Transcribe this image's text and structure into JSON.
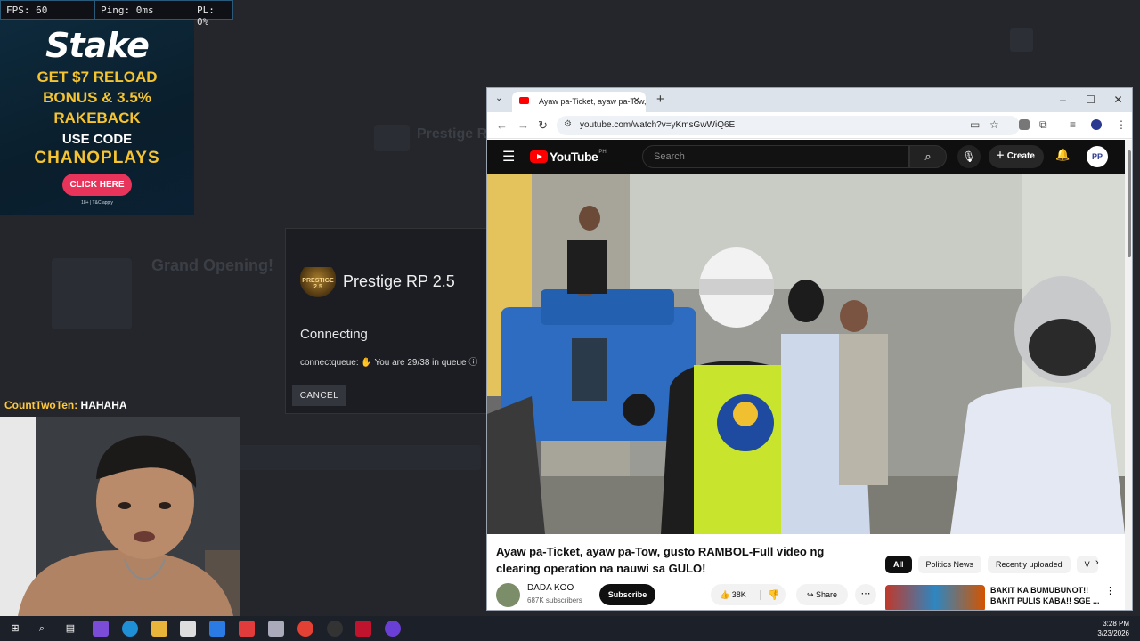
{
  "perf": {
    "fps": "FPS: 60",
    "ping": "Ping: 0ms",
    "pl": "PL: 0%"
  },
  "ad": {
    "brand": "Stake",
    "line1": "GET $7 RELOAD",
    "line2": "BONUS & 3.5%",
    "line3": "RAKEBACK",
    "use_code": "USE CODE",
    "code": "CHANOPLAYS",
    "cta": "CLICK HERE",
    "fine_print": "18+ | T&C apply"
  },
  "background": {
    "heading": "Grand Opening!",
    "server_faded": "Prestige RP"
  },
  "connect_modal": {
    "logo_text": "PRESTIGE 2.5",
    "server_name": "Prestige RP 2.5",
    "status": "Connecting",
    "queue_label": "connectqueue:",
    "queue_text": "You are 29/38 in queue",
    "cancel": "CANCEL"
  },
  "chat": {
    "user": "CountTwoTen:",
    "message": "HAHAHA"
  },
  "browser": {
    "tab_title": "Ayaw pa-Ticket, ayaw pa-Tow,",
    "url": "youtube.com/watch?v=yKmsGwWiQ6E",
    "window_controls": [
      "–",
      "☐",
      "✕"
    ]
  },
  "youtube": {
    "logo": "YouTube",
    "country": "PH",
    "search_placeholder": "Search",
    "create": "Create",
    "avatar": "PP",
    "video_title": "Ayaw pa-Ticket, ayaw pa-Tow, gusto RAMBOL-Full video ng clearing operation na nauwi sa GULO!",
    "channel": "DADA KOO",
    "subscribers": "687K subscribers",
    "subscribe": "Subscribe",
    "likes": "38K",
    "share": "Share",
    "chips": [
      "All",
      "Politics News",
      "Recently uploaded",
      "V"
    ],
    "rec_title": "BAKIT KA BUMUBUNOT!! BAKIT PULIS KABA!! SGE ..."
  },
  "clock": {
    "time": "3:28 PM",
    "date": "3/23/2026"
  }
}
